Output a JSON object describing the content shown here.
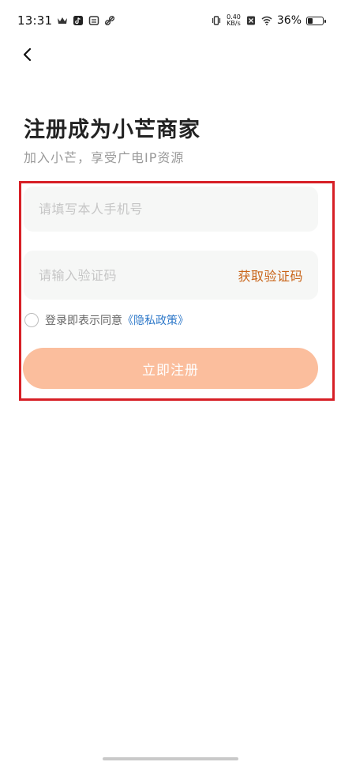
{
  "status_bar": {
    "time": "13:31",
    "net_speed_value": "0.40",
    "net_speed_unit": "KB/s",
    "battery_percent": "36%",
    "battery_level": 0.36,
    "icons": [
      "crown-icon",
      "tiktok-icon",
      "mail-box-icon",
      "link-icon",
      "vibrate-icon",
      "sim-off-icon",
      "wifi-icon",
      "battery-icon"
    ]
  },
  "header": {
    "title": "注册成为小芒商家",
    "subtitle": "加入小芒，享受广电IP资源"
  },
  "form": {
    "phone_placeholder": "请填写本人手机号",
    "code_placeholder": "请输入验证码",
    "get_code_label": "获取验证码",
    "agree_text": "登录即表示同意",
    "privacy_link": "《隐私政策》",
    "submit_label": "立即注册"
  },
  "colors": {
    "accent": "#c9651a",
    "button_bg": "#fbbe9d",
    "link": "#2f79c9",
    "highlight": "#d71f26"
  }
}
